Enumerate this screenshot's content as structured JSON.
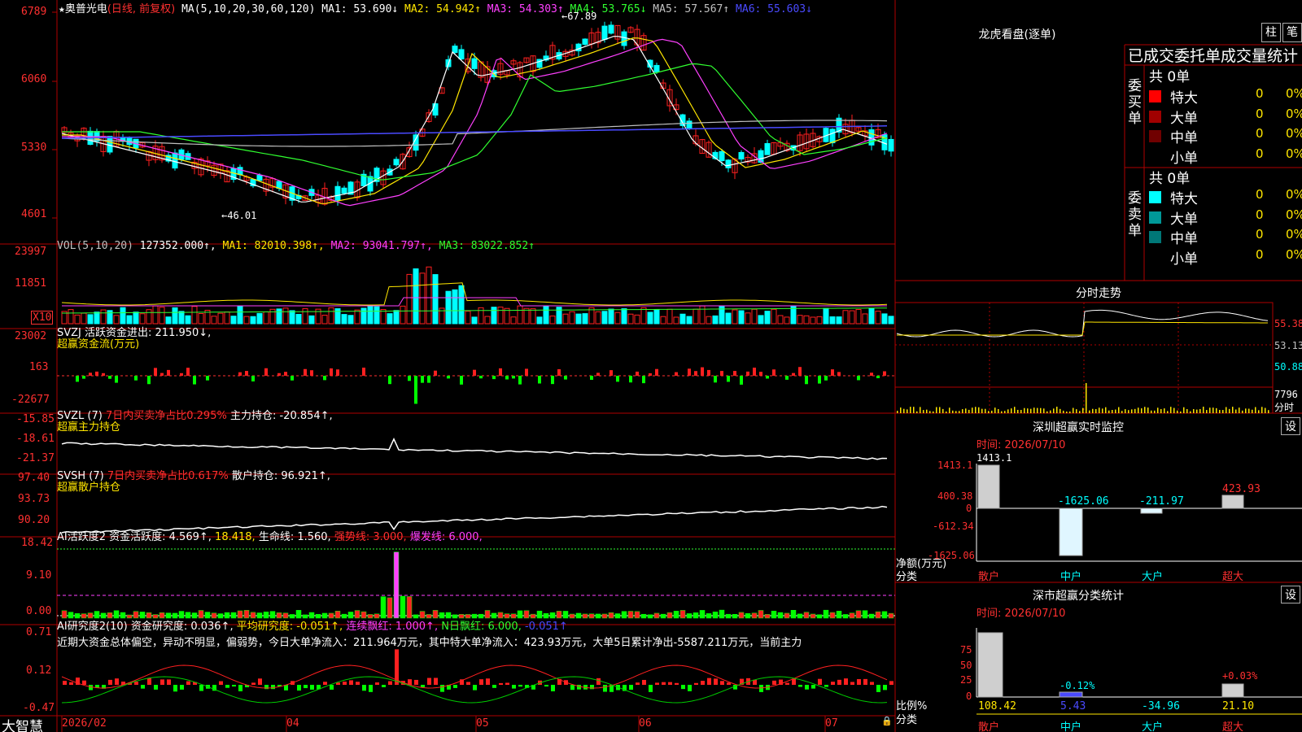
{
  "stock": {
    "name_prefix": "★",
    "name": "奥普光电",
    "mode": "(日线, 前复权)",
    "ma_header": "MA(5,10,20,30,60,120)",
    "ma": [
      {
        "label": "MA1:",
        "value": "53.690",
        "arrow": "↓",
        "color": "#ffffff"
      },
      {
        "label": "MA2:",
        "value": "54.942",
        "arrow": "↑",
        "color": "#ffe600"
      },
      {
        "label": "MA3:",
        "value": "54.303",
        "arrow": "↑",
        "color": "#ff40ff"
      },
      {
        "label": "MA4:",
        "value": "53.765",
        "arrow": "↓",
        "color": "#30ff30"
      },
      {
        "label": "MA5:",
        "value": "57.567",
        "arrow": "↑",
        "color": "#c0c0c0"
      },
      {
        "label": "MA6:",
        "value": "55.603",
        "arrow": "↓",
        "color": "#4a4aff"
      }
    ],
    "high_marker": "←67.89",
    "low_marker": "←46.01"
  },
  "price_axis": [
    "6789",
    "6060",
    "5330",
    "4601"
  ],
  "vol": {
    "header": "VOL(5,10,20)",
    "value": "127352.000↑,",
    "ma1": "MA1: 82010.398↑,",
    "ma2": "MA2: 93041.797↑,",
    "ma3": "MA3: 83022.852↑",
    "axis": [
      "23997",
      "11851"
    ],
    "unit": "X10"
  },
  "svzj": {
    "header": "SVZJ  活跃资金进出: 211.950↓,",
    "sub": "超赢资金流(万元)",
    "axis": [
      "23002",
      "163",
      "-22677"
    ]
  },
  "svzl": {
    "header_a": "SVZL (7)",
    "header_b": "7日内买卖净占比0.295%",
    "header_c": "主力持仓: -20.854↑,",
    "sub": "超赢主力持仓",
    "axis": [
      "-15.85",
      "-18.61",
      "-21.37"
    ]
  },
  "svsh": {
    "header_a": "SVSH (7)",
    "header_b": "7日内买卖净占比0.617%",
    "header_c": "散户持仓: 96.921↑,",
    "sub": "超赢散户持仓",
    "axis": [
      "97.40",
      "93.73",
      "90.20"
    ]
  },
  "ai1": {
    "h1": "AI活跃度2",
    "h2": "资金活跃度: 4.569↑,",
    "h3": "18.418,",
    "h4": "生命线: 1.560,",
    "h5": "强势线: 3.000,",
    "h6": "爆发线: 6.000,",
    "axis": [
      "18.42",
      "9.10",
      "0.00"
    ]
  },
  "ai2": {
    "h1": "AI研究度2(10)",
    "h2": "资金研究度: 0.036↑,",
    "h3": "平均研究度: -0.051↑,",
    "h4": "连续飘红: 1.000↑,",
    "h5": "N日飘红: 6.000,",
    "h6": "-0.051↑",
    "text": "近期大资金总体偏空，异动不明显，偏弱势，今日大单净流入：211.964万元，其中特大单净流入：423.93万元，大单5日累计净出-5587.211万元，当前主力",
    "axis": [
      "0.71",
      "0.12",
      "-0.47"
    ]
  },
  "xaxis": {
    "brand": "大智慧",
    "dates": [
      "2026/02",
      "04",
      "05",
      "06",
      "07"
    ]
  },
  "right": {
    "lhb_title": "龙虎看盘(逐单)",
    "btn_zhu": "柱",
    "btn_bi": "笔",
    "stats_title": "已成交委托单成交量统计",
    "buy_label": "委买单",
    "sell_label": "委卖单",
    "buy_total": "共 0单",
    "sell_total": "共 0单",
    "buy_rows": [
      {
        "name": "特大",
        "v": "0",
        "p": "0%",
        "color": "#ff0000"
      },
      {
        "name": "大单",
        "v": "0",
        "p": "0%",
        "color": "#a00000"
      },
      {
        "name": "中单",
        "v": "0",
        "p": "0%",
        "color": "#700000"
      },
      {
        "name": "小单",
        "v": "0",
        "p": "0%",
        "color": ""
      }
    ],
    "sell_rows": [
      {
        "name": "特大",
        "v": "0",
        "p": "0%",
        "color": "#00ffff"
      },
      {
        "name": "大单",
        "v": "0",
        "p": "0%",
        "color": "#009999"
      },
      {
        "name": "中单",
        "v": "0",
        "p": "0%",
        "color": "#007777"
      },
      {
        "name": "小单",
        "v": "0",
        "p": "0%",
        "color": ""
      }
    ],
    "intraday_title": "分时走势",
    "intraday_axis": [
      "55.38",
      "53.13",
      "50.88",
      "7796",
      "分时"
    ],
    "monitor_title": "深圳超赢实时监控",
    "monitor_btn": "设",
    "monitor_time": "时间: 2026/07/10",
    "monitor_axis": [
      "1413.1",
      "400.38",
      "0",
      "-612.34",
      "-1625.06"
    ],
    "monitor_unit_a": "净额(万元)",
    "monitor_unit_b": "分类",
    "monitor_values": [
      "1413.1",
      "-1625.06",
      "-211.97",
      "423.93"
    ],
    "categories": [
      "散户",
      "中户",
      "大户",
      "超大"
    ],
    "class_title": "深市超赢分类统计",
    "class_btn": "设",
    "class_time": "时间: 2026/07/10",
    "class_axis": [
      "75",
      "50",
      "25",
      "0"
    ],
    "class_unit_a": "比例%",
    "class_unit_b": "分类",
    "class_top": [
      "-0.12%",
      "+0.03%"
    ],
    "class_values": [
      "108.42",
      "5.43",
      "-34.96",
      "21.10"
    ]
  }
}
